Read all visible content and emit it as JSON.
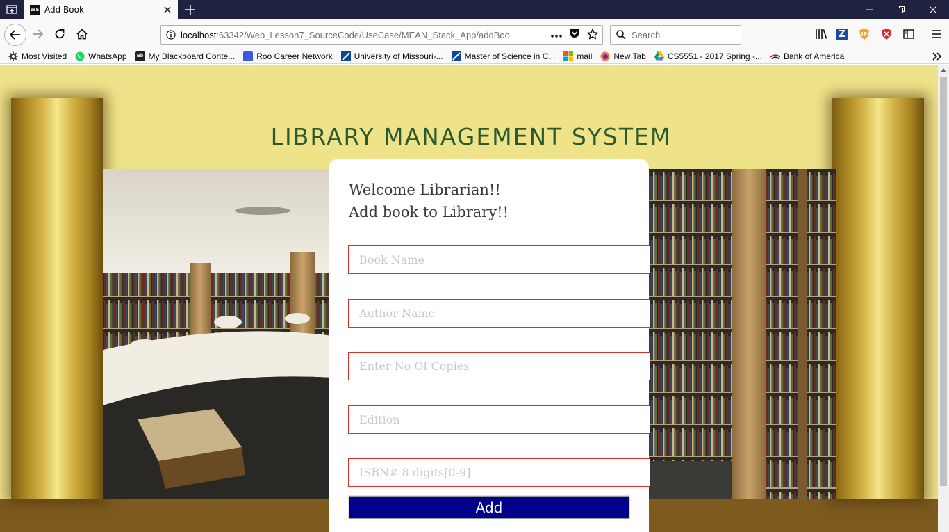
{
  "browser": {
    "tab": {
      "title": "Add Book",
      "favicon": "WS"
    },
    "url": {
      "host": "localhost",
      "path": ":63342/Web_Lesson7_SourceCode/UseCase/MEAN_Stack_App/addBoo"
    },
    "search_placeholder": "Search",
    "bookmarks": [
      {
        "label": "Most Visited",
        "icon": "gear-icon",
        "color": "#444444"
      },
      {
        "label": "WhatsApp",
        "icon": "whatsapp-icon",
        "color": "#25d366"
      },
      {
        "label": "My Blackboard Conte...",
        "icon": "blackboard-icon",
        "color": "#222222"
      },
      {
        "label": "Roo Career Network",
        "icon": "roo-icon",
        "color": "#3b5bdb"
      },
      {
        "label": "University of Missouri-...",
        "icon": "umkc-icon",
        "color": "#0a4a9e"
      },
      {
        "label": "Master of Science in C...",
        "icon": "umkc-icon",
        "color": "#0a4a9e"
      },
      {
        "label": "mail",
        "icon": "microsoft-icon",
        "color": "#f25022"
      },
      {
        "label": "New Tab",
        "icon": "firefox-icon",
        "color": "#ff7139"
      },
      {
        "label": "CS5551 - 2017 Spring -...",
        "icon": "google-drive-icon",
        "color": "#fbbc04"
      },
      {
        "label": "Bank of America",
        "icon": "bofa-icon",
        "color": "#c8102e"
      }
    ]
  },
  "page": {
    "site_title": "LIBRARY MANAGEMENT SYSTEM",
    "heading_line1": "Welcome Librarian!!",
    "heading_line2": "Add book to Library!!",
    "fields": {
      "book_name": {
        "placeholder": "Book Name",
        "value": ""
      },
      "author_name": {
        "placeholder": "Author Name",
        "value": ""
      },
      "copies": {
        "placeholder": "Enter No Of Copies",
        "value": ""
      },
      "edition": {
        "placeholder": "Edition",
        "value": ""
      },
      "isbn": {
        "placeholder": "ISBN# 8 digits[0-9]",
        "value": ""
      }
    },
    "add_button": "Add"
  },
  "colors": {
    "accent_button": "#00008b",
    "invalid_border": "#d93025",
    "title_green": "#2c5a30",
    "banner_yellow": "#efe38a"
  }
}
